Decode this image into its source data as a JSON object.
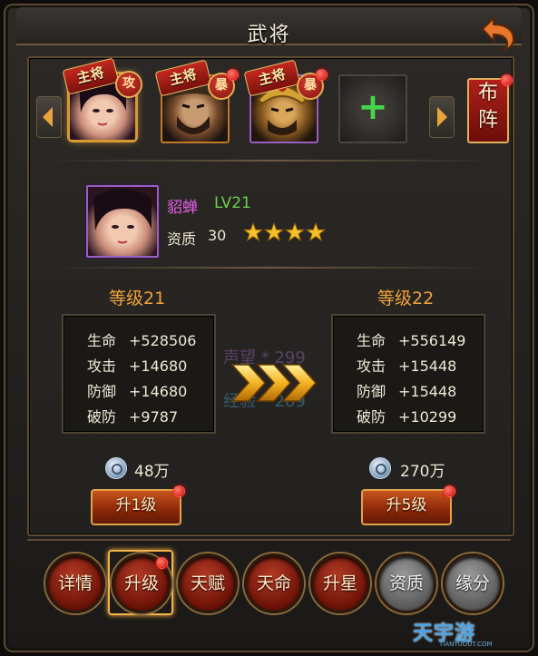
{
  "header": {
    "title": "武将"
  },
  "hero_slots": [
    {
      "ribbon": "主将",
      "tag": "攻",
      "selected": true
    },
    {
      "ribbon": "主将",
      "tag": "暴",
      "selected": false
    },
    {
      "ribbon": "主将",
      "tag": "暴",
      "selected": false
    }
  ],
  "formation_button": {
    "label_top": "布",
    "label_bottom": "阵"
  },
  "hero": {
    "name": "貂蝉",
    "level": "LV21",
    "quality_label": "资质",
    "quality_value": "30",
    "stars": 4
  },
  "current": {
    "level_title": "等级21",
    "stats": [
      {
        "label": "生命",
        "value": "+528506"
      },
      {
        "label": "攻击",
        "value": "+14680"
      },
      {
        "label": "防御",
        "value": "+14680"
      },
      {
        "label": "破防",
        "value": "+9787"
      }
    ],
    "cost": "48万",
    "button": "升1级"
  },
  "next": {
    "level_title": "等级22",
    "stats": [
      {
        "label": "生命",
        "value": "+556149"
      },
      {
        "label": "攻击",
        "value": "+15448"
      },
      {
        "label": "防御",
        "value": "+15448"
      },
      {
        "label": "破防",
        "value": "+10299"
      }
    ],
    "cost": "270万",
    "button": "升5级"
  },
  "background_text": {
    "line1": "声望 * 299",
    "line2": "经验 * 269"
  },
  "tabs": [
    "详情",
    "升级",
    "天赋",
    "天命",
    "升星",
    "资质",
    "缘分"
  ],
  "watermark": {
    "text": "天宇游",
    "sub": "TIANYUOUT.COM"
  },
  "colors": {
    "accent": "#eea33a",
    "name": "#e35de5",
    "level": "#6ad24a"
  }
}
